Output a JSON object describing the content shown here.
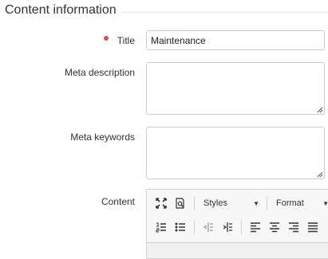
{
  "section": {
    "title": "Content information"
  },
  "form": {
    "title": {
      "label": "Title",
      "value": "Maintenance",
      "required": true
    },
    "meta_description": {
      "label": "Meta description",
      "value": ""
    },
    "meta_keywords": {
      "label": "Meta keywords",
      "value": ""
    },
    "content": {
      "label": "Content"
    }
  },
  "editor": {
    "toolbar_row1": [
      "maximize-icon",
      "preview-icon",
      "styles-combo",
      "format-combo"
    ],
    "styles_label": "Styles",
    "format_label": "Format",
    "toolbar_row2": [
      "numbered-list-icon",
      "bulleted-list-icon",
      "decrease-indent-icon",
      "increase-indent-icon",
      "align-left-icon",
      "align-center-icon",
      "align-right-icon",
      "justify-icon"
    ]
  },
  "colors": {
    "required": "#d9534f",
    "border": "#cccccc"
  }
}
